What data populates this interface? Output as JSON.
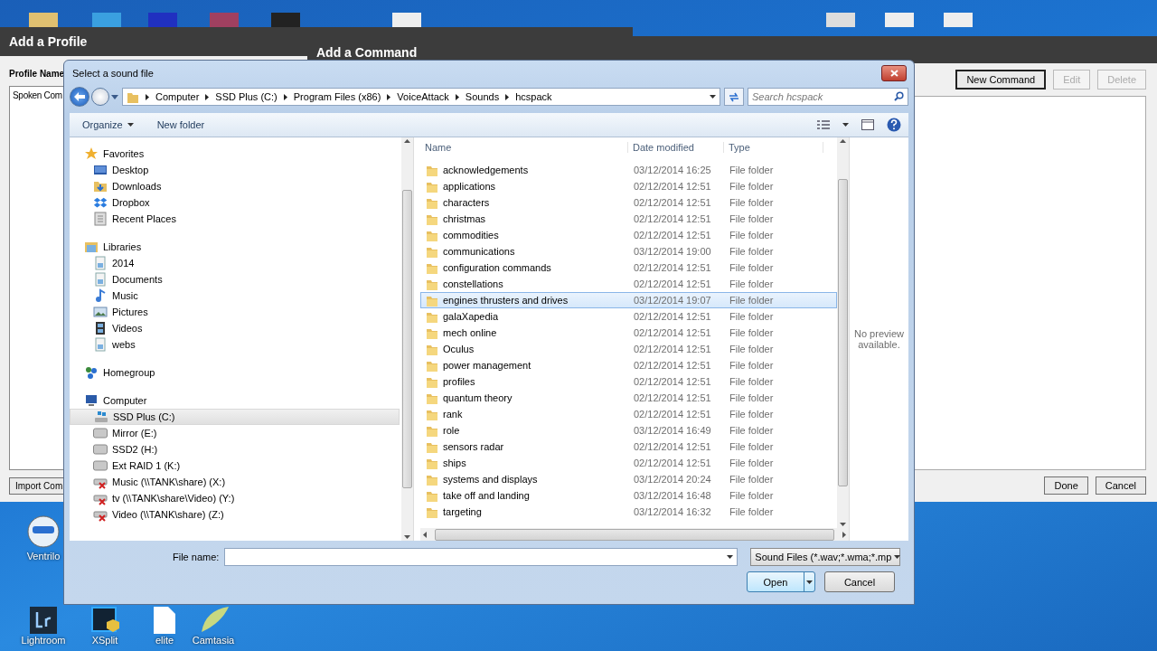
{
  "desktop": {
    "icons": [
      {
        "label": "Ventrilo",
        "kind": "ventrilo"
      },
      {
        "label": "Lightroom",
        "kind": "lightroom"
      },
      {
        "label": "XSplit",
        "kind": "xsplit"
      },
      {
        "label": "elite",
        "kind": "file"
      },
      {
        "label": "Camtasia",
        "kind": "camtasia"
      }
    ]
  },
  "profile_window": {
    "title": "Add a Profile",
    "name_label": "Profile Name",
    "list_header": "Spoken Com",
    "import_button": "Import Com"
  },
  "command_window": {
    "title": "Add a Command",
    "buttons": [
      {
        "label": "New Command",
        "disabled": false
      },
      {
        "label": "Edit",
        "disabled": true
      },
      {
        "label": "Delete",
        "disabled": true
      }
    ],
    "footer_buttons": [
      {
        "label": "Done"
      },
      {
        "label": "Cancel"
      }
    ]
  },
  "dialog": {
    "title": "Select a sound file",
    "breadcrumb": [
      "Computer",
      "SSD Plus (C:)",
      "Program Files (x86)",
      "VoiceAttack",
      "Sounds",
      "hcspack"
    ],
    "search": {
      "placeholder": "Search hcspack"
    },
    "toolbar": [
      {
        "label": "Organize",
        "dropdown": true
      },
      {
        "label": "New folder",
        "dropdown": false
      }
    ],
    "nav": [
      {
        "label": "Favorites",
        "kind": "favorites",
        "selected": false,
        "children": [
          {
            "label": "Desktop",
            "kind": "desktop",
            "selected": false
          },
          {
            "label": "Downloads",
            "kind": "downloads",
            "selected": false
          },
          {
            "label": "Dropbox",
            "kind": "dropbox",
            "selected": false
          },
          {
            "label": "Recent Places",
            "kind": "recent",
            "selected": false
          }
        ]
      },
      {
        "label": "Libraries",
        "kind": "libraries",
        "selected": false,
        "children": [
          {
            "label": "2014",
            "kind": "library",
            "selected": false
          },
          {
            "label": "Documents",
            "kind": "documents",
            "selected": false
          },
          {
            "label": "Music",
            "kind": "music",
            "selected": false
          },
          {
            "label": "Pictures",
            "kind": "pictures",
            "selected": false
          },
          {
            "label": "Videos",
            "kind": "videos",
            "selected": false
          },
          {
            "label": "webs",
            "kind": "library",
            "selected": false
          }
        ]
      },
      {
        "label": "Homegroup",
        "kind": "homegroup",
        "selected": false
      },
      {
        "label": "Computer",
        "kind": "computer",
        "selected": false,
        "children": [
          {
            "label": "SSD Plus (C:)",
            "kind": "system-drive",
            "selected": true
          },
          {
            "label": "Mirror (E:)",
            "kind": "drive",
            "selected": false
          },
          {
            "label": "SSD2 (H:)",
            "kind": "drive",
            "selected": false
          },
          {
            "label": "Ext RAID 1 (K:)",
            "kind": "drive",
            "selected": false
          },
          {
            "label": "Music (\\\\TANK\\share) (X:)",
            "kind": "network-drive",
            "selected": false
          },
          {
            "label": "tv (\\\\TANK\\share\\Video) (Y:)",
            "kind": "network-drive",
            "selected": false
          },
          {
            "label": "Video (\\\\TANK\\share) (Z:)",
            "kind": "network-drive",
            "selected": false
          }
        ]
      }
    ],
    "columns": [
      "Name",
      "Date modified",
      "Type"
    ],
    "rows": [
      {
        "name": "acknowledgements",
        "date": "03/12/2014 16:25",
        "type": "File folder",
        "selected": false
      },
      {
        "name": "applications",
        "date": "02/12/2014 12:51",
        "type": "File folder",
        "selected": false
      },
      {
        "name": "characters",
        "date": "02/12/2014 12:51",
        "type": "File folder",
        "selected": false
      },
      {
        "name": "christmas",
        "date": "02/12/2014 12:51",
        "type": "File folder",
        "selected": false
      },
      {
        "name": "commodities",
        "date": "02/12/2014 12:51",
        "type": "File folder",
        "selected": false
      },
      {
        "name": "communications",
        "date": "03/12/2014 19:00",
        "type": "File folder",
        "selected": false
      },
      {
        "name": "configuration commands",
        "date": "02/12/2014 12:51",
        "type": "File folder",
        "selected": false
      },
      {
        "name": "constellations",
        "date": "02/12/2014 12:51",
        "type": "File folder",
        "selected": false
      },
      {
        "name": "engines thrusters and drives",
        "date": "03/12/2014 19:07",
        "type": "File folder",
        "selected": true
      },
      {
        "name": "galaXapedia",
        "date": "02/12/2014 12:51",
        "type": "File folder",
        "selected": false
      },
      {
        "name": "mech online",
        "date": "02/12/2014 12:51",
        "type": "File folder",
        "selected": false
      },
      {
        "name": "Oculus",
        "date": "02/12/2014 12:51",
        "type": "File folder",
        "selected": false
      },
      {
        "name": "power management",
        "date": "02/12/2014 12:51",
        "type": "File folder",
        "selected": false
      },
      {
        "name": "profiles",
        "date": "02/12/2014 12:51",
        "type": "File folder",
        "selected": false
      },
      {
        "name": "quantum theory",
        "date": "02/12/2014 12:51",
        "type": "File folder",
        "selected": false
      },
      {
        "name": "rank",
        "date": "02/12/2014 12:51",
        "type": "File folder",
        "selected": false
      },
      {
        "name": "role",
        "date": "03/12/2014 16:49",
        "type": "File folder",
        "selected": false
      },
      {
        "name": "sensors radar",
        "date": "02/12/2014 12:51",
        "type": "File folder",
        "selected": false
      },
      {
        "name": "ships",
        "date": "02/12/2014 12:51",
        "type": "File folder",
        "selected": false
      },
      {
        "name": "systems and displays",
        "date": "03/12/2014 20:24",
        "type": "File folder",
        "selected": false
      },
      {
        "name": "take off and landing",
        "date": "03/12/2014 16:48",
        "type": "File folder",
        "selected": false
      },
      {
        "name": "targeting",
        "date": "03/12/2014 16:32",
        "type": "File folder",
        "selected": false
      }
    ],
    "preview_text": "No preview available.",
    "file_name_label": "File name:",
    "filter": "Sound Files (*.wav;*.wma;*.mp",
    "open_button": "Open",
    "cancel_button": "Cancel"
  }
}
